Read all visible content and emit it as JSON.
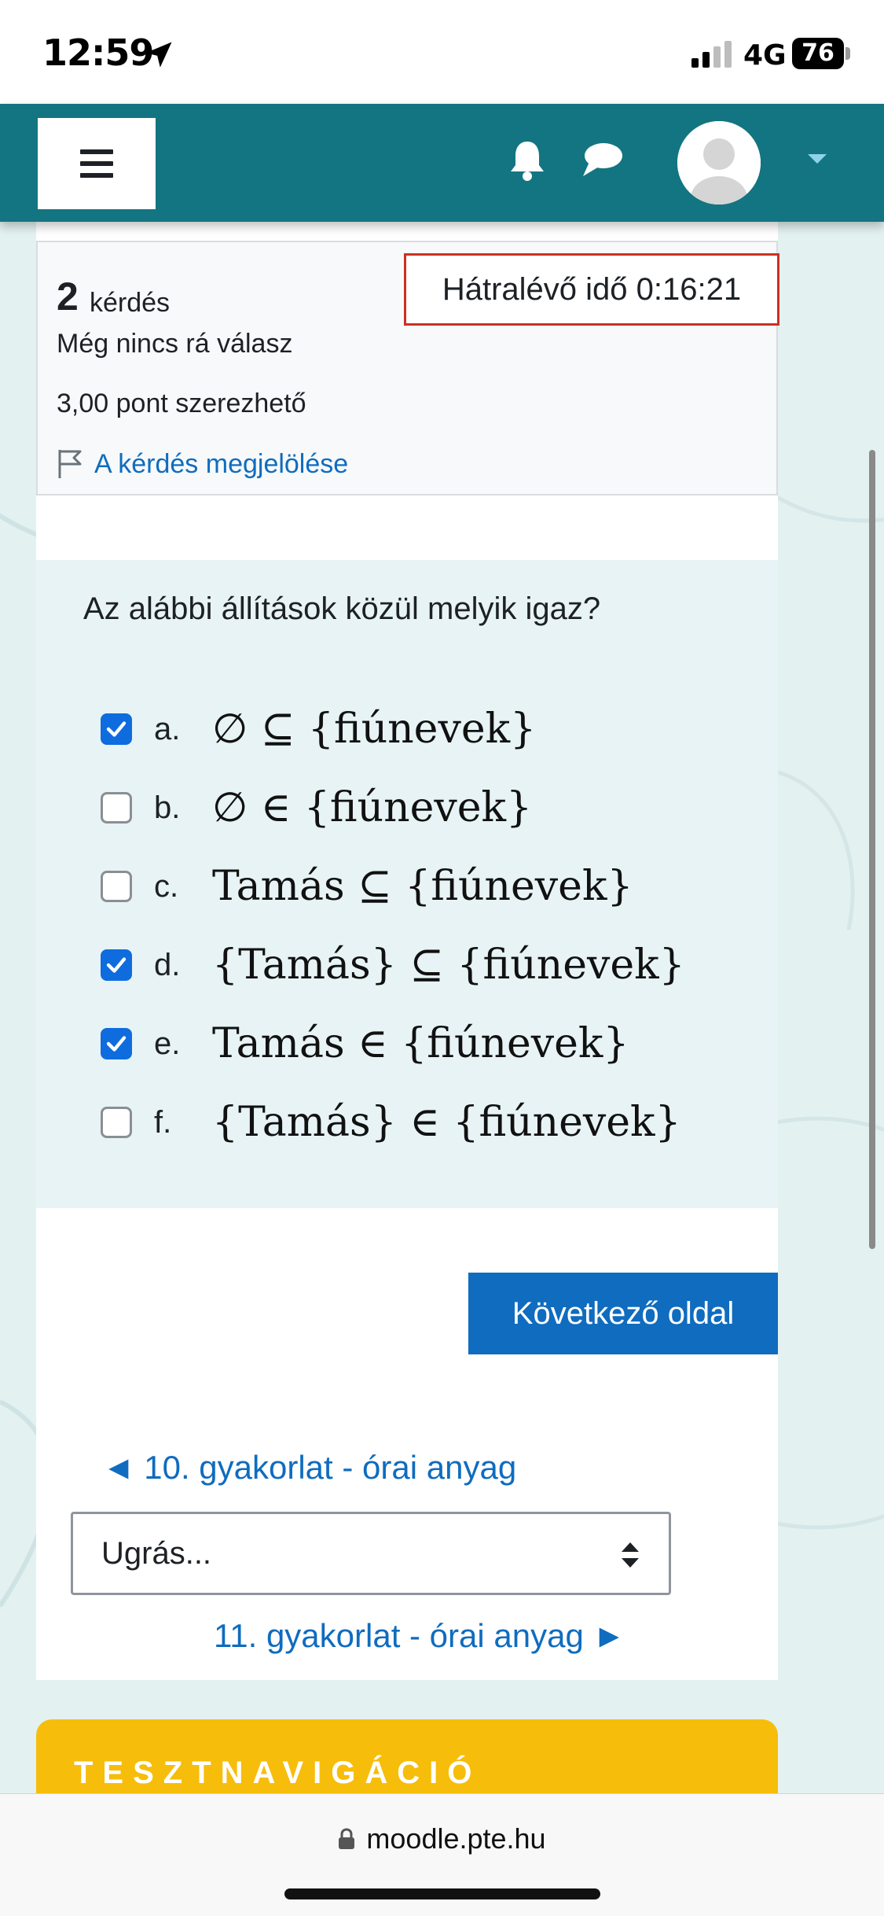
{
  "status_bar": {
    "time": "12:59",
    "network": "4G",
    "battery": "76"
  },
  "header": {
    "menu_icon": "hamburger-icon",
    "notifications_icon": "bell-icon",
    "messages_icon": "chat-icon",
    "user_icon": "avatar-icon",
    "user_menu_icon": "caret-down-icon",
    "brand_color": "#137581"
  },
  "question_info": {
    "number": "2",
    "number_label": "kérdés",
    "state": "Még nincs rá válasz",
    "grade": "3,00 pont szerezhető",
    "flag_label": "A kérdés megjelölése",
    "timer": "Hátralévő idő 0:16:21"
  },
  "question": {
    "text": "Az alábbi állítások közül melyik igaz?",
    "options": [
      {
        "letter": "a.",
        "math": "∅ ⊆ {fiúnevek}",
        "checked": true
      },
      {
        "letter": "b.",
        "math": "∅ ∈ {fiúnevek}",
        "checked": false
      },
      {
        "letter": "c.",
        "math": "Tamás ⊆ {fiúnevek}",
        "checked": false
      },
      {
        "letter": "d.",
        "math": "{Tamás} ⊆ {fiúnevek}",
        "checked": true
      },
      {
        "letter": "e.",
        "math": "Tamás ∈ {fiúnevek}",
        "checked": true
      },
      {
        "letter": "f.",
        "math": "{Tamás} ∈ {fiúnevek}",
        "checked": false
      }
    ]
  },
  "navigation": {
    "next_page_label": "Következő oldal",
    "prev_activity": "◄ 10. gyakorlat - órai anyag",
    "jump_placeholder": "Ugrás...",
    "next_activity": "11. gyakorlat - órai anyag ►",
    "quiz_nav_title": "TESZTNAVIGÁCIÓ",
    "quiz_nav_color": "#f7bd0b"
  },
  "browser": {
    "url": "moodle.pte.hu"
  }
}
